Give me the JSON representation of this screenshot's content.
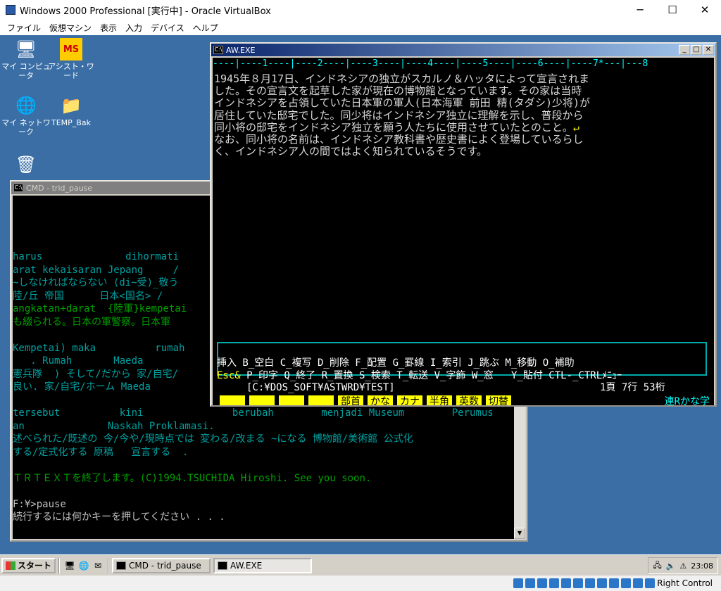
{
  "host": {
    "title": "Windows 2000 Professional [実行中] - Oracle VirtualBox",
    "controls": {
      "minimize": "─",
      "maximize": "☐",
      "close": "✕"
    },
    "menu": [
      "ファイル",
      "仮想マシン",
      "表示",
      "入力",
      "デバイス",
      "ヘルプ"
    ],
    "status": {
      "host_key": "Right Control"
    }
  },
  "desktop": {
    "icons": [
      {
        "label": "マイ コンピュータ",
        "glyph": "🖥"
      },
      {
        "label": "アシスト・ワード",
        "glyph": "MS"
      },
      {
        "label": "マイ ネットワーク",
        "glyph": "🌐"
      },
      {
        "label": "TEMP_Bak",
        "glyph": "📁"
      },
      {
        "label": "",
        "glyph": "🗑"
      }
    ]
  },
  "cmd": {
    "title": "CMD - trid_pause",
    "lines": [
      {
        "t": "harus              dihormati",
        "c": "teal"
      },
      {
        "t": "arat kekaisaran Jepang     /",
        "c": "teal"
      },
      {
        "t": "~しなければならない (di~受)_敬う",
        "c": "teal"
      },
      {
        "t": "陸/丘 帝国      日本<国名> /",
        "c": "teal"
      },
      {
        "t": "angkatan+darat  {陸軍}kempetai",
        "c": "green"
      },
      {
        "t": "も綴られる。日本の軍警察。日本軍",
        "c": "green"
      },
      {
        "t": "",
        "c": "teal"
      },
      {
        "t": "Kempetai) maka          rumah",
        "c": "teal"
      },
      {
        "t": "   . Rumah       Maeda",
        "c": "teal"
      },
      {
        "t": "憲兵隊  ) そして/だから 家/自宅/",
        "c": "teal"
      },
      {
        "t": "良い. 家/自宅/ホーム Maeda",
        "c": "teal"
      },
      {
        "t": "",
        "c": "teal"
      },
      {
        "t": "tersebut          kini               berubah        menjadi Museum        Perumus",
        "c": "teal"
      },
      {
        "t": "an              Naskah Proklamasi.",
        "c": "teal"
      },
      {
        "t": "述べられた/既述の 今/今や/現時点では 変わる/改まる ~になる 博物館/美術館 公式化",
        "c": "teal"
      },
      {
        "t": "する/定式化する 原稿   宣言する  .",
        "c": "teal"
      },
      {
        "t": "",
        "c": "teal"
      },
      {
        "t": "ＴＲＴＥＸＴを終了します。(C)1994.TSUCHIDA Hiroshi. See you soon.",
        "c": "green"
      },
      {
        "t": "",
        "c": "teal"
      },
      {
        "t": "F:¥>pause",
        "c": "white"
      },
      {
        "t": "続行するには何かキーを押してください . . .",
        "c": "white"
      }
    ]
  },
  "aw": {
    "title": "AW.EXE",
    "ruler": "----|----1----|----2----|----3----|----4----|----5----|----6----|----7*---|---8",
    "text": [
      "1945年８月17日、インドネシアの独立がスカルノ＆ハッタによって宣言されま",
      "した。その宣言文を起草した家が現在の博物館となっています。その家は当時",
      "インドネシアを占領していた日本軍の軍人(日本海軍 前田 精(タダシ)少将)が",
      "居住していた邸宅でした。同少将はインドネシア独立に理解を示し、普段から",
      "同小将の邸宅をインドネシア独立を願う人たちに使用させていたとのこと。",
      "なお、同小将の名前は、インドネシア教科書や歴史書によく登場しているらし",
      "く、インドネシア人の間ではよく知られているそうです。"
    ],
    "return_mark": "↵",
    "menu1": "挿入 B_空白 C_複写 D_削除 F_配置 G_罫線 I_索引 J_跳ぶ M_移動 O_補助",
    "menu2_esc": "Esc&",
    "menu2": " P_印字 Q_終了 R_置換 S_検索 T_転送 V_字飾 W_窓   Y_貼付 CTL-_CTRLﾒﾆｭｰ",
    "path": "[C:¥DOS_SOFT¥ASTWRD¥TEST]",
    "position": "1頁 7行 53桁",
    "fkeys": [
      "",
      "",
      "",
      "",
      "部首",
      "かな",
      "カナ",
      "半角",
      "英数",
      "切替"
    ],
    "mode": "連Rかな学"
  },
  "taskbar": {
    "start": "スタート",
    "tasks": [
      {
        "label": "CMD - trid_pause",
        "active": false
      },
      {
        "label": "AW.EXE",
        "active": true
      }
    ],
    "clock": "23:08"
  }
}
